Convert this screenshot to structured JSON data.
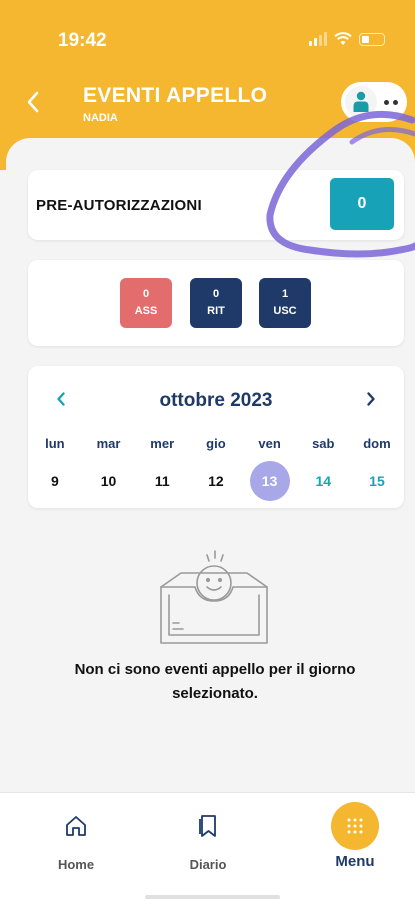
{
  "status_bar": {
    "time": "19:42"
  },
  "header": {
    "title": "EVENTI APPELLO",
    "subtitle": "NADIA"
  },
  "pre_authorizations": {
    "label": "PRE-AUTORIZZAZIONI",
    "count": "0"
  },
  "badges": [
    {
      "value": "0",
      "label": "ASS",
      "color": "#e36c6c"
    },
    {
      "value": "0",
      "label": "RIT",
      "color": "#1f3a68"
    },
    {
      "value": "1",
      "label": "USC",
      "color": "#1f3a68"
    }
  ],
  "calendar": {
    "month_label": "ottobre 2023",
    "weekdays": [
      "lun",
      "mar",
      "mer",
      "gio",
      "ven",
      "sab",
      "dom"
    ],
    "days": [
      "9",
      "10",
      "11",
      "12",
      "13",
      "14",
      "15"
    ],
    "selected_day": "13"
  },
  "empty_state": {
    "message": "Non ci sono eventi appello per il giorno selezionato."
  },
  "tabbar": {
    "home": "Home",
    "diario": "Diario",
    "menu": "Menu"
  },
  "colors": {
    "brand_yellow": "#f5b72f",
    "navy": "#1f3a68",
    "teal": "#17a2b8",
    "selected_day": "#a8a8e8",
    "marker_purple": "#7b66d8"
  },
  "icons": [
    "back-chevron-icon",
    "user-icon",
    "more-dots-icon",
    "chevron-left-icon",
    "chevron-right-icon",
    "empty-inbox-icon",
    "home-icon",
    "bookmark-icon",
    "menu-grid-icon"
  ]
}
